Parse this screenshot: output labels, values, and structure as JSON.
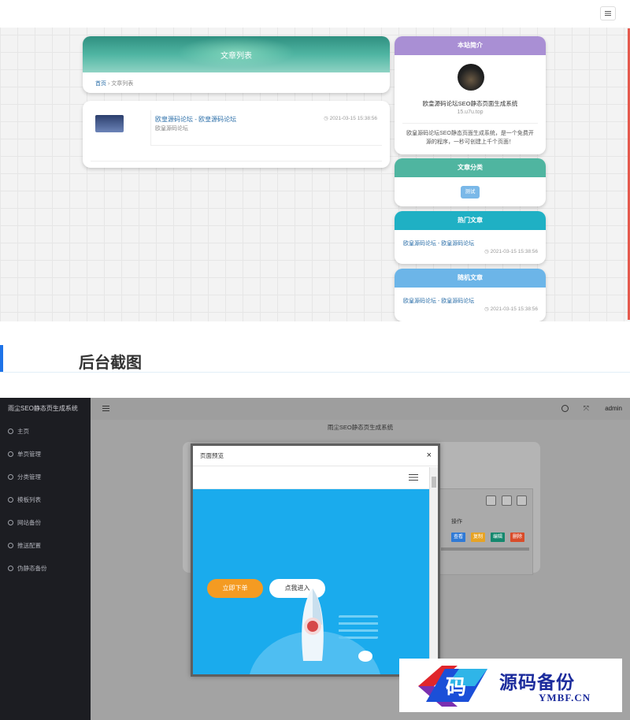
{
  "front": {
    "list_card": {
      "title": "文章列表",
      "breadcrumb_home": "首页",
      "breadcrumb_sep": " › ",
      "breadcrumb_current": "文章列表"
    },
    "article": {
      "title": "欧皇源码论坛 - 欧皇源码论坛",
      "subtitle": "欧皇源码论坛",
      "date": "2021-03-15 15:38:56"
    },
    "intro_card": {
      "title": "本站简介",
      "name": "欧皇源码论坛SEO静态页面生成系统",
      "url": "15.u7u.top",
      "desc": "欧皇源码论坛SEO静态页面生成系统，是一个免费开源的程序，一秒可创建上千个页面！"
    },
    "category_card": {
      "title": "文章分类",
      "tag": "测试"
    },
    "hot_card": {
      "title": "热门文章",
      "item_title": "欧皇源码论坛 - 欧皇源码论坛",
      "item_date": "2021-03-15 15:38:56"
    },
    "random_card": {
      "title": "随机文章",
      "item_title": "欧皇源码论坛 - 欧皇源码论坛",
      "item_date": "2021-03-15 15:38:56"
    }
  },
  "section": {
    "title": "后台截图"
  },
  "admin": {
    "brand": "雨尘SEO静态页生成系统",
    "nav": [
      {
        "label": "主页"
      },
      {
        "label": "单页管理"
      },
      {
        "label": "分类管理"
      },
      {
        "label": "模板列表"
      },
      {
        "label": "网站备份"
      },
      {
        "label": "推送配置"
      },
      {
        "label": "伪静态备份"
      }
    ],
    "header_user": "admin",
    "subtitle": "雨尘SEO静态页生成系统",
    "table": {
      "ops_header": "操作",
      "ops": [
        {
          "label": "查看",
          "color": "#2f7ad6"
        },
        {
          "label": "复制",
          "color": "#e7a324"
        },
        {
          "label": "编辑",
          "color": "#14886e"
        },
        {
          "label": "删除",
          "color": "#d94c2a"
        }
      ]
    },
    "modal": {
      "title": "页面预览",
      "close": "×",
      "btn_order": "立即下单",
      "btn_enter": "点我进入"
    }
  },
  "watermark": {
    "cn": "源码备份",
    "en": "YMBF.CN",
    "logo_char": "码"
  }
}
